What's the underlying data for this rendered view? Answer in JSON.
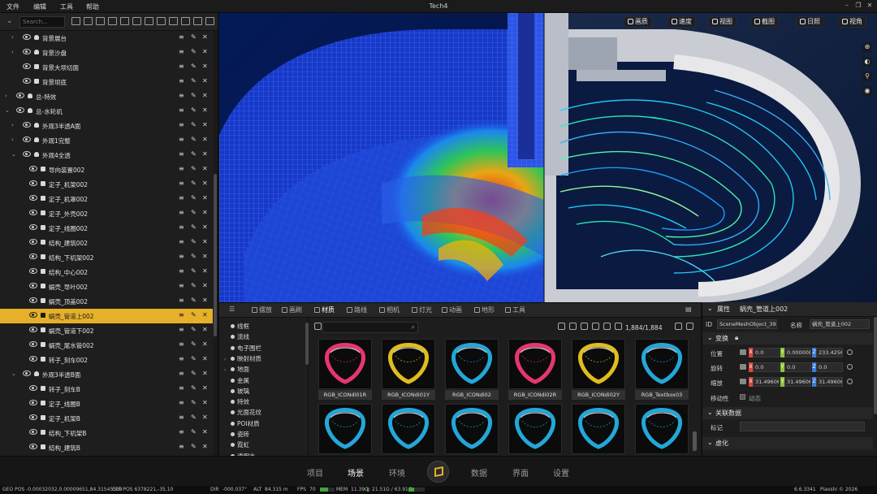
{
  "menubar": {
    "items": [
      "文件",
      "编辑",
      "工具",
      "帮助"
    ],
    "title": "Tech4"
  },
  "tree": {
    "search_placeholder": "Search...",
    "rows": [
      {
        "label": "背景展台",
        "expand": "›",
        "kind": "bulb"
      },
      {
        "label": "背景沙盘",
        "expand": "›",
        "kind": "bulb"
      },
      {
        "label": "背景大坝切面",
        "expand": "",
        "kind": "mesh"
      },
      {
        "label": "背景坝底",
        "expand": "",
        "kind": "mesh"
      },
      {
        "label": "总-特效",
        "expand": "›",
        "kind": "bulb"
      },
      {
        "label": "总-水轮机",
        "expand": "⌄",
        "kind": "bulb"
      },
      {
        "label": "外观3半透A面",
        "expand": "›",
        "kind": "bulb"
      },
      {
        "label": "外观1完整",
        "expand": "›",
        "kind": "bulb"
      },
      {
        "label": "外观4全透",
        "expand": "⌄",
        "kind": "bulb"
      },
      {
        "label": "导向装置002",
        "expand": "",
        "kind": "mesh"
      },
      {
        "label": "定子_机架002",
        "expand": "",
        "kind": "mesh"
      },
      {
        "label": "定子_机罩002",
        "expand": "",
        "kind": "mesh"
      },
      {
        "label": "定子_外壳002",
        "expand": "",
        "kind": "mesh"
      },
      {
        "label": "定子_线圈002",
        "expand": "",
        "kind": "mesh"
      },
      {
        "label": "结构_建筑002",
        "expand": "",
        "kind": "mesh"
      },
      {
        "label": "结构_下机架002",
        "expand": "",
        "kind": "mesh"
      },
      {
        "label": "结构_中心002",
        "expand": "",
        "kind": "mesh"
      },
      {
        "label": "蜗壳_导叶002",
        "expand": "",
        "kind": "mesh"
      },
      {
        "label": "蜗壳_顶盖002",
        "expand": "",
        "kind": "mesh"
      },
      {
        "label": "蜗壳_管道上002",
        "expand": "",
        "kind": "mesh",
        "selected": true
      },
      {
        "label": "蜗壳_管道下002",
        "expand": "",
        "kind": "mesh"
      },
      {
        "label": "蜗壳_尾水管002",
        "expand": "",
        "kind": "mesh"
      },
      {
        "label": "转子_刻车002",
        "expand": "",
        "kind": "mesh"
      },
      {
        "label": "外观3半透B面",
        "expand": "⌄",
        "kind": "bulb"
      },
      {
        "label": "转子_刻车B",
        "expand": "",
        "kind": "mesh"
      },
      {
        "label": "定子_线圈B",
        "expand": "",
        "kind": "mesh"
      },
      {
        "label": "定子_机架B",
        "expand": "",
        "kind": "mesh"
      },
      {
        "label": "结构_下机架B",
        "expand": "",
        "kind": "mesh"
      },
      {
        "label": "结构_建筑B",
        "expand": "",
        "kind": "mesh"
      }
    ]
  },
  "viewport": {
    "buttons": [
      "画质",
      "速度",
      "视图",
      "截图",
      "日照",
      "视角"
    ],
    "side_tools": [
      "⊕",
      "◐",
      "⚲",
      "◉"
    ]
  },
  "assets": {
    "tabs": [
      "摆放",
      "画刷",
      "材质",
      "路线",
      "相机",
      "灯光",
      "动画",
      "地形",
      "工具"
    ],
    "active_tab": "材质",
    "menu_glyph": "☰",
    "categories": [
      {
        "label": "线框",
        "arrow": ""
      },
      {
        "label": "流线",
        "arrow": ""
      },
      {
        "label": "电子围栏",
        "arrow": ""
      },
      {
        "label": "映射材质",
        "arrow": "›"
      },
      {
        "label": "地面",
        "arrow": "›"
      },
      {
        "label": "金属",
        "arrow": ""
      },
      {
        "label": "玻璃",
        "arrow": ""
      },
      {
        "label": "特效",
        "arrow": ""
      },
      {
        "label": "光面花纹",
        "arrow": ""
      },
      {
        "label": "POI材质",
        "arrow": ""
      },
      {
        "label": "瓷砖",
        "arrow": ""
      },
      {
        "label": "霓虹",
        "arrow": ""
      },
      {
        "label": "透明水",
        "arrow": ""
      }
    ],
    "count": "1,884/1,884",
    "items": [
      {
        "name": "RGB_ICONdi01R",
        "color": "#ff3b78"
      },
      {
        "name": "RGB_ICONdi01Y",
        "color": "#f6d020"
      },
      {
        "name": "RGB_ICONdi02",
        "color": "#27b7f0"
      },
      {
        "name": "RGB_ICONdi02R",
        "color": "#ff3b78"
      },
      {
        "name": "RGB_ICONdi02Y",
        "color": "#f6d020"
      },
      {
        "name": "RGB_Textbox03",
        "color": "#27b7f0"
      },
      {
        "name": "",
        "color": "#27b7f0"
      },
      {
        "name": "",
        "color": "#27b7f0"
      },
      {
        "name": "",
        "color": "#27b7f0"
      },
      {
        "name": "",
        "color": "#27b7f0"
      },
      {
        "name": "",
        "color": "#27b7f0"
      },
      {
        "name": "",
        "color": "#27b7f0"
      }
    ]
  },
  "props": {
    "header_label": "属性",
    "object_title": "蜗壳_管道上002",
    "id_label": "ID",
    "id_value": "SceneMeshObject_39",
    "name_label": "名称",
    "name_value": "蜗壳_管道上002",
    "transform_label": "变换",
    "position_label": "位置",
    "position": {
      "x": "0.0",
      "y": "0.000008",
      "z": "233.4256"
    },
    "rotation_label": "旋转",
    "rotation": {
      "x": "0.0",
      "y": "0.0",
      "z": "0.0"
    },
    "scale_label": "缩放",
    "scale": {
      "x": "31.49606",
      "y": "31.49606",
      "z": "31.49606"
    },
    "mobility_label": "移动性",
    "mobility_value": "动态",
    "related_label": "关联数据",
    "tag_label": "标记",
    "virtual_label": "虚化"
  },
  "bottomnav": {
    "left": [
      "项目",
      "场景",
      "环境"
    ],
    "right": [
      "数据",
      "界面",
      "设置"
    ],
    "active": "场景"
  },
  "statusbar": {
    "geo": "GEO POS -0.00032032,0.00009651,84.31545519",
    "cef": "CEF POS 6378221,-35,10",
    "dir_label": "DIR",
    "dir": "-000.037°",
    "alt_label": "ALT",
    "alt": "84.315 m",
    "fps_label": "FPS",
    "fps": "70",
    "fps_fraction": 0.55,
    "mem_label": "MEM",
    "mem": "11.39G",
    "mem_fraction": 0.6,
    "vram": "21.51G / 63.91G",
    "vram_fraction": 0.34,
    "version": "6.6.3341",
    "copyright": "Piaoshi © 2026"
  },
  "colors": {
    "accent": "#e6b02a",
    "panel": "#1e1e1e"
  }
}
